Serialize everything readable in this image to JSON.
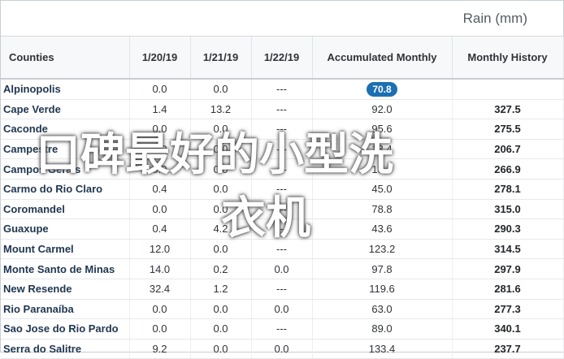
{
  "header": {
    "title": "Rain (mm)"
  },
  "table": {
    "columns": [
      "Counties",
      "1/20/19",
      "1/21/19",
      "1/22/19",
      "Accumulated Monthly",
      "Monthly History"
    ],
    "rows": [
      [
        "Alpinopolis",
        "0.0",
        "0.0",
        "---",
        "70.8",
        ""
      ],
      [
        "Cape Verde",
        "1.4",
        "13.2",
        "---",
        "92.0",
        "327.5"
      ],
      [
        "Caconde",
        "0.0",
        "0.0",
        "---",
        "95.6",
        "275.5"
      ],
      [
        "Campestre",
        "0.0",
        "0.0",
        "---",
        "13.4",
        "206.7"
      ],
      [
        "Campos Gerais",
        "0.0",
        "0.0",
        "---",
        "13.4",
        "266.9"
      ],
      [
        "Carmo do Rio Claro",
        "0.4",
        "0.0",
        "---",
        "45.0",
        "278.1"
      ],
      [
        "Coromandel",
        "0.0",
        "0.0",
        "---",
        "78.8",
        "315.0"
      ],
      [
        "Guaxupe",
        "0.4",
        "4.2",
        "---",
        "43.6",
        "290.3"
      ],
      [
        "Mount Carmel",
        "12.0",
        "0.0",
        "---",
        "123.2",
        "314.5"
      ],
      [
        "Monte Santo de Minas",
        "14.0",
        "0.2",
        "0.0",
        "97.8",
        "297.9"
      ],
      [
        "New Resende",
        "32.4",
        "1.2",
        "---",
        "119.6",
        "281.6"
      ],
      [
        "Rio Paranaíba",
        "0.0",
        "0.0",
        "0.0",
        "63.0",
        "277.3"
      ],
      [
        "Sao Jose do Rio Pardo",
        "0.0",
        "0.0",
        "---",
        "89.0",
        "340.1"
      ],
      [
        "Serra do Salitre",
        "9.2",
        "0.0",
        "0.0",
        "133.4",
        "237.7"
      ]
    ],
    "highlight_color": "#1b6fb3"
  },
  "overlay": {
    "line1": "口碑最好的小型洗",
    "line2": "衣机"
  }
}
